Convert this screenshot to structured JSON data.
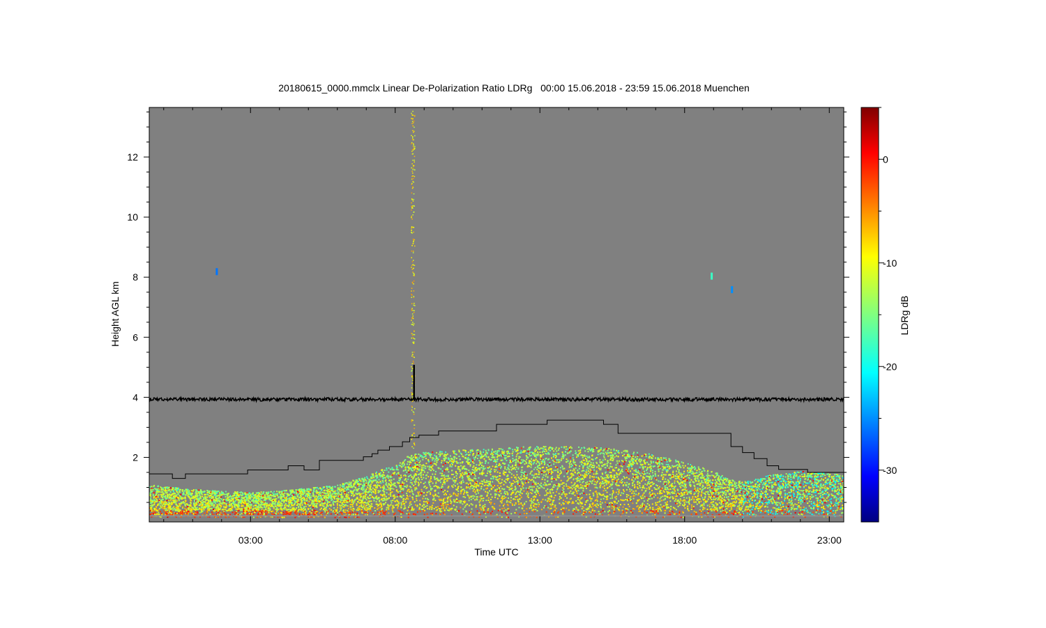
{
  "chart_data": {
    "type": "heatmap",
    "title": "20180615_0000.mmclx Linear De-Polarization Ratio LDRg   00:00 15.06.2018 - 23:59 15.06.2018 Muenchen",
    "xlabel": "Time UTC",
    "ylabel": "Height AGL km",
    "colorbar_label": "LDRg dB",
    "x_ticks": [
      "03:00",
      "08:00",
      "13:00",
      "18:00",
      "23:00"
    ],
    "x_tick_hours": [
      3,
      8,
      13,
      18,
      23
    ],
    "xlim_hours": [
      -0.5,
      23.5
    ],
    "y_ticks": [
      "2",
      "4",
      "6",
      "8",
      "10",
      "12"
    ],
    "y_tick_values": [
      2,
      4,
      6,
      8,
      10,
      12
    ],
    "ylim_km": [
      -0.15,
      13.65
    ],
    "colorbar_ticks": [
      "0",
      "-10",
      "-20",
      "-30"
    ],
    "colorbar_tick_values": [
      0,
      -10,
      -20,
      -30
    ],
    "colorbar_range_db": [
      -35,
      5
    ],
    "background_color": "#808080",
    "colormap": "jet",
    "layer_line_km": 3.93,
    "spike": {
      "hour": 8.65,
      "top_km": 5.08
    },
    "precip_streak": {
      "hour": 8.6,
      "top_km": 13.6
    },
    "blh_line": {
      "hours": [
        -0.5,
        0.3,
        0.3,
        0.75,
        0.75,
        2.9,
        2.9,
        4.3,
        4.3,
        4.85,
        4.85,
        5.38,
        5.38,
        6.9,
        6.9,
        7.2,
        7.2,
        7.4,
        7.4,
        7.8,
        7.8,
        8.25,
        8.25,
        8.5,
        8.5,
        8.82,
        8.82,
        9.5,
        9.5,
        11.5,
        11.5,
        13.25,
        13.25,
        15.2,
        15.2,
        15.7,
        15.7,
        19.6,
        19.6,
        20.0,
        20.0,
        20.4,
        20.4,
        20.85,
        20.85,
        21.25,
        21.25,
        22.25,
        22.25,
        23.5,
        23.5
      ],
      "km": [
        1.45,
        1.45,
        1.3,
        1.3,
        1.45,
        1.45,
        1.58,
        1.58,
        1.72,
        1.72,
        1.58,
        1.58,
        1.9,
        1.9,
        2.02,
        2.02,
        2.12,
        2.12,
        2.24,
        2.24,
        2.36,
        2.36,
        2.52,
        2.52,
        2.66,
        2.66,
        2.74,
        2.74,
        2.88,
        2.88,
        3.1,
        3.1,
        3.24,
        3.24,
        3.1,
        3.1,
        2.8,
        2.8,
        2.36,
        2.36,
        2.16,
        2.16,
        1.96,
        1.96,
        1.72,
        1.72,
        1.6,
        1.6,
        1.5,
        1.5,
        1.45
      ]
    },
    "echo_top_km": {
      "hours": [
        -0.5,
        1,
        2,
        3,
        4,
        5,
        6,
        6.5,
        7,
        7.5,
        8,
        8.3,
        8.5,
        9,
        10,
        11,
        12,
        13,
        14,
        15,
        16,
        17,
        18,
        19,
        19.5,
        20,
        20.5,
        21,
        22,
        23,
        23.5
      ],
      "km": [
        1.1,
        0.95,
        0.9,
        0.85,
        0.9,
        1.0,
        1.1,
        1.25,
        1.4,
        1.6,
        1.8,
        1.95,
        2.15,
        2.2,
        2.25,
        2.3,
        2.35,
        2.4,
        2.4,
        2.35,
        2.25,
        2.1,
        1.85,
        1.55,
        1.3,
        1.2,
        1.3,
        1.45,
        1.55,
        1.5,
        1.4
      ]
    },
    "isolated_echoes": [
      {
        "hour": 1.8,
        "km": 8.3,
        "db": -26
      },
      {
        "hour": 19.6,
        "km": 7.7,
        "db": -25
      },
      {
        "hour": 18.9,
        "km": 8.15,
        "db": -18
      }
    ]
  }
}
